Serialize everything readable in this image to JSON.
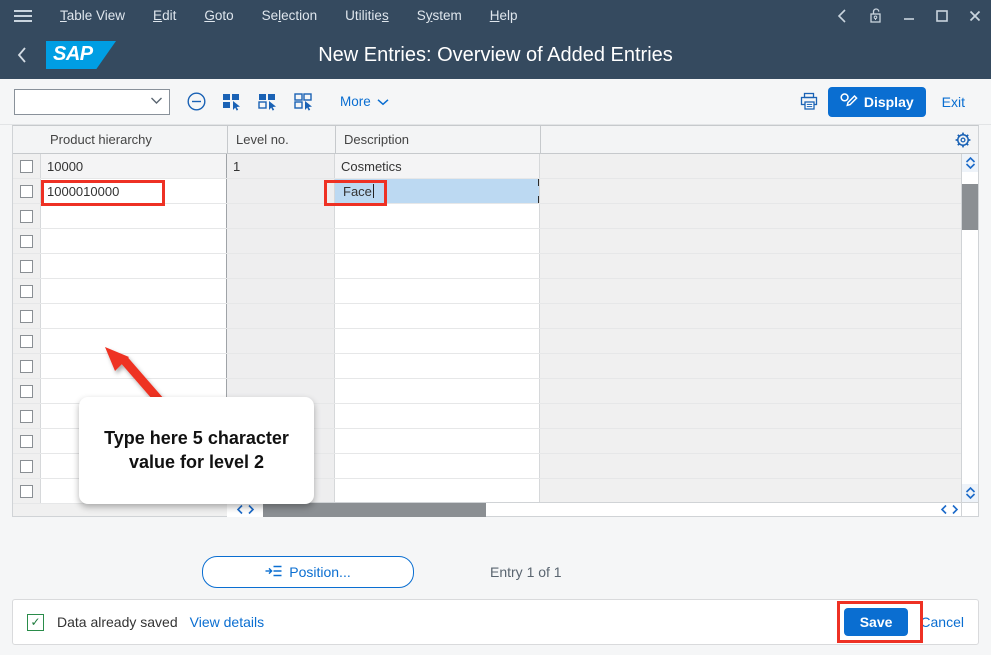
{
  "menubar": {
    "hamburger_icon": "hamburger-icon",
    "items": [
      {
        "pre": "",
        "key": "T",
        "post": "able View"
      },
      {
        "pre": "",
        "key": "E",
        "post": "dit"
      },
      {
        "pre": "",
        "key": "G",
        "post": "oto"
      },
      {
        "pre": "Se",
        "key": "l",
        "post": "ection"
      },
      {
        "pre": "Utilitie",
        "key": "s",
        "post": ""
      },
      {
        "pre": "S",
        "key": "y",
        "post": "stem"
      },
      {
        "pre": "",
        "key": "H",
        "post": "elp"
      }
    ],
    "window_controls": [
      {
        "name": "back-icon",
        "glyph": "‹"
      },
      {
        "name": "lock-open-icon",
        "glyph": ""
      },
      {
        "name": "minimize-icon",
        "glyph": "—"
      },
      {
        "name": "maximize-icon",
        "glyph": "□"
      },
      {
        "name": "close-icon",
        "glyph": "✕"
      }
    ]
  },
  "shellbar": {
    "back_glyph": "‹",
    "logo_text": "SAP",
    "title": "New Entries: Overview of Added Entries"
  },
  "toolbar": {
    "variant_value": "",
    "variant_chevron": "⌄",
    "more_label": "More",
    "more_chevron": "⌄",
    "display_label": "Display",
    "exit_label": "Exit",
    "icons": [
      {
        "name": "delete-row-icon"
      },
      {
        "name": "select-all-icon"
      },
      {
        "name": "select-block-icon"
      },
      {
        "name": "deselect-all-icon"
      },
      {
        "name": "print-icon"
      }
    ]
  },
  "table": {
    "columns": [
      "Product hierarchy",
      "Level no.",
      "Description"
    ],
    "settings_icon": "gear-icon",
    "rows": [
      {
        "product_hierarchy": "10000",
        "level_no": "1",
        "description": "Cosmetics",
        "editing": false,
        "highlight": false
      },
      {
        "product_hierarchy": "1000010000",
        "level_no": "",
        "description": "Face",
        "editing": true,
        "highlight": true
      },
      {
        "product_hierarchy": "",
        "level_no": "",
        "description": "",
        "editing": false,
        "highlight": false
      },
      {
        "product_hierarchy": "",
        "level_no": "",
        "description": "",
        "editing": false,
        "highlight": false
      },
      {
        "product_hierarchy": "",
        "level_no": "",
        "description": "",
        "editing": false,
        "highlight": false
      },
      {
        "product_hierarchy": "",
        "level_no": "",
        "description": "",
        "editing": false,
        "highlight": false
      },
      {
        "product_hierarchy": "",
        "level_no": "",
        "description": "",
        "editing": false,
        "highlight": false
      },
      {
        "product_hierarchy": "",
        "level_no": "",
        "description": "",
        "editing": false,
        "highlight": false
      },
      {
        "product_hierarchy": "",
        "level_no": "",
        "description": "",
        "editing": false,
        "highlight": false
      },
      {
        "product_hierarchy": "",
        "level_no": "",
        "description": "",
        "editing": false,
        "highlight": false
      },
      {
        "product_hierarchy": "",
        "level_no": "",
        "description": "",
        "editing": false,
        "highlight": false
      },
      {
        "product_hierarchy": "",
        "level_no": "",
        "description": "",
        "editing": false,
        "highlight": false
      },
      {
        "product_hierarchy": "",
        "level_no": "",
        "description": "",
        "editing": false,
        "highlight": false
      },
      {
        "product_hierarchy": "",
        "level_no": "",
        "description": "",
        "editing": false,
        "highlight": false
      }
    ]
  },
  "annotation": {
    "callout_text": "Type here 5 character value for level 2",
    "color": "#ee3124"
  },
  "footer": {
    "position_label": "Position...",
    "position_icon": "arrow-to-list-icon",
    "entry_text": "Entry 1 of 1"
  },
  "statusbar": {
    "check_glyph": "✓",
    "message": "Data already saved",
    "details_link": "View details",
    "save_label": "Save",
    "cancel_label": "Cancel"
  },
  "colors": {
    "header_bg": "#354a5f",
    "accent_blue": "#0a6ed1",
    "sap_cyan": "#009ee3",
    "annotation_red": "#ee3124",
    "selection_blue": "#bcd9f2",
    "success_green": "#2a8c4a"
  }
}
